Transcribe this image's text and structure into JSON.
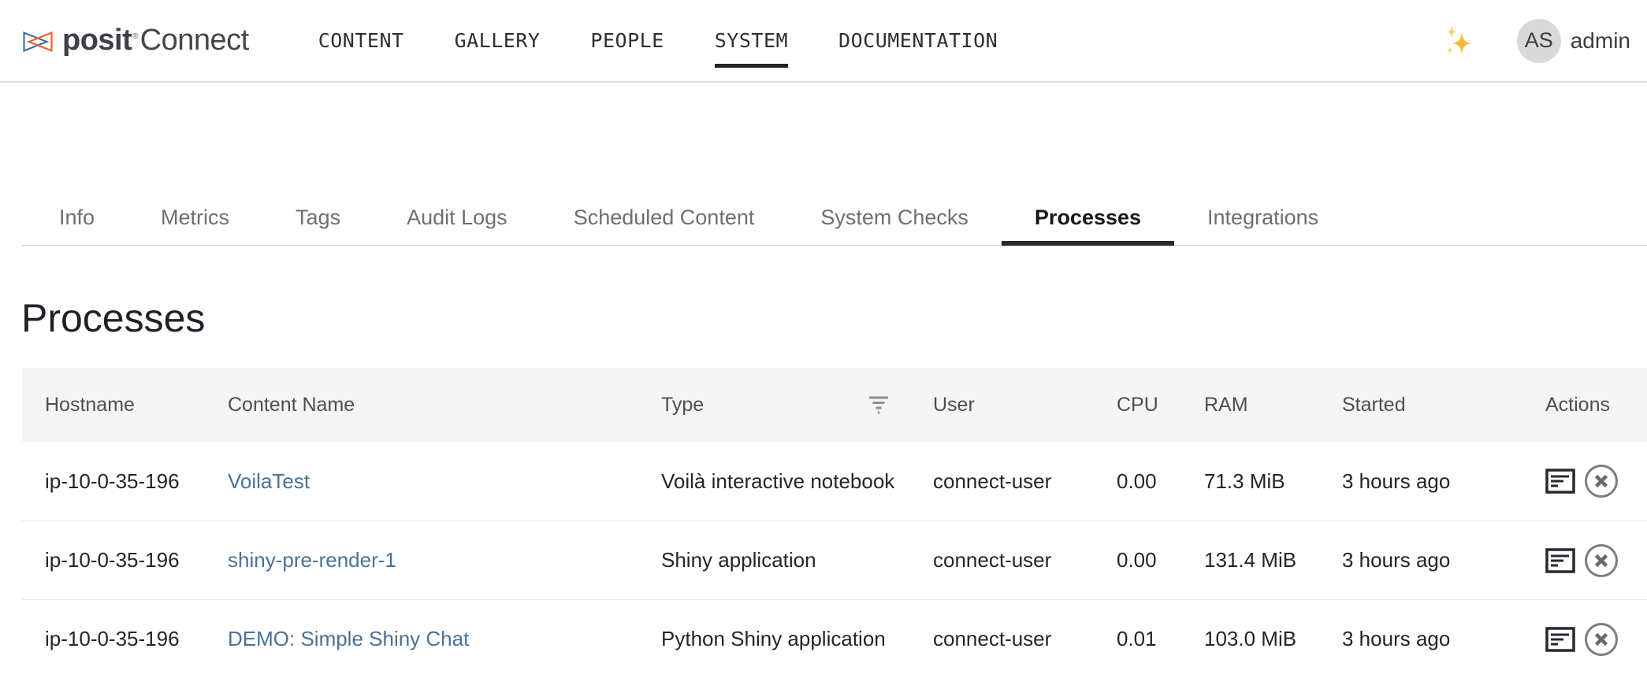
{
  "brand": {
    "product": "posit",
    "registered": "®",
    "suffix": "Connect",
    "mark_blue": "#447099",
    "mark_orange": "#EE6331"
  },
  "nav": {
    "items": [
      {
        "label": "CONTENT",
        "active": false
      },
      {
        "label": "GALLERY",
        "active": false
      },
      {
        "label": "PEOPLE",
        "active": false
      },
      {
        "label": "SYSTEM",
        "active": true
      },
      {
        "label": "DOCUMENTATION",
        "active": false
      }
    ]
  },
  "user": {
    "initials": "AS",
    "name": "admin"
  },
  "icons": {
    "sparkles": "sparkles-icon",
    "filter": "filter-icon",
    "log": "process-log-icon",
    "kill": "kill-process-icon",
    "sparkles_color": "#f1bf36"
  },
  "tabs": [
    {
      "label": "Info",
      "active": false
    },
    {
      "label": "Metrics",
      "active": false
    },
    {
      "label": "Tags",
      "active": false
    },
    {
      "label": "Audit Logs",
      "active": false
    },
    {
      "label": "Scheduled Content",
      "active": false
    },
    {
      "label": "System Checks",
      "active": false
    },
    {
      "label": "Processes",
      "active": true
    },
    {
      "label": "Integrations",
      "active": false
    }
  ],
  "page": {
    "title": "Processes"
  },
  "table": {
    "columns": [
      "Hostname",
      "Content Name",
      "Type",
      "User",
      "CPU",
      "RAM",
      "Started",
      "Actions"
    ],
    "rows": [
      {
        "hostname": "ip-10-0-35-196",
        "content_name": "VoilaTest",
        "type": "Voilà interactive notebook",
        "user": "connect-user",
        "cpu": "0.00",
        "ram": "71.3 MiB",
        "started": "3 hours ago"
      },
      {
        "hostname": "ip-10-0-35-196",
        "content_name": "shiny-pre-render-1",
        "type": "Shiny application",
        "user": "connect-user",
        "cpu": "0.00",
        "ram": "131.4 MiB",
        "started": "3 hours ago"
      },
      {
        "hostname": "ip-10-0-35-196",
        "content_name": "DEMO: Simple Shiny Chat",
        "type": "Python Shiny application",
        "user": "connect-user",
        "cpu": "0.01",
        "ram": "103.0 MiB",
        "started": "3 hours ago"
      }
    ]
  },
  "colors": {
    "link": "#4a7296",
    "active_tab_underline": "#2a2a2a",
    "header_bg": "#f5f5f6",
    "topbar_border": "#d9e0e9"
  }
}
